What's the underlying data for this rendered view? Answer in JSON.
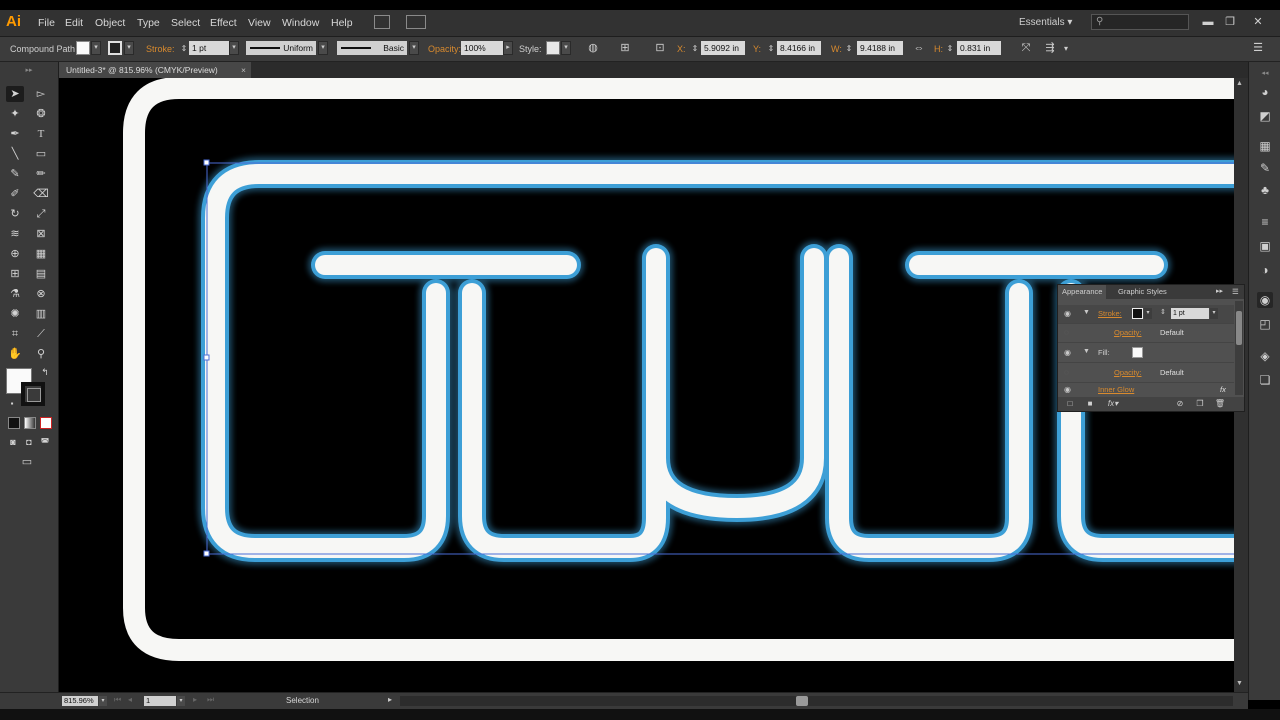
{
  "app": {
    "logo": "Ai"
  },
  "menu": [
    "File",
    "Edit",
    "Object",
    "Type",
    "Select",
    "Effect",
    "View",
    "Window",
    "Help"
  ],
  "workspace": "Essentials",
  "search": {
    "placeholder": ""
  },
  "window_controls": [
    "minimize-icon",
    "restore-icon",
    "close-icon"
  ],
  "controlbar": {
    "selection_type": "Compound Path",
    "stroke_label": "Stroke:",
    "stroke_weight": "1 pt",
    "variable_width": "Uniform",
    "brush": "Basic",
    "opacity_label": "Opacity:",
    "opacity_value": "100%",
    "style_label": "Style:",
    "x_label": "X:",
    "x_value": "5.9092 in",
    "y_label": "Y:",
    "y_value": "8.4166 in",
    "w_label": "W:",
    "w_value": "9.4188 in",
    "h_label": "H:",
    "h_value": "0.831 in"
  },
  "document_tab": {
    "title": "Untitled-3* @ 815.96% (CMYK/Preview)",
    "close": "×"
  },
  "canvas": {
    "artwork_text": "TUTS"
  },
  "appearance_panel": {
    "tabs": [
      "Appearance",
      "Graphic Styles"
    ],
    "rows": [
      {
        "type": "attribute",
        "label": "Stroke:",
        "value": "1 pt",
        "selected": true
      },
      {
        "type": "sub",
        "label": "Opacity:",
        "value": "Default"
      },
      {
        "type": "attribute",
        "label": "Fill:",
        "value": ""
      },
      {
        "type": "sub",
        "label": "Opacity:",
        "value": "Default"
      },
      {
        "type": "effect",
        "label": "Inner Glow",
        "value": "fx"
      }
    ]
  },
  "statusbar": {
    "zoom": "815.96%",
    "artboard": "1",
    "tool_status": "Selection"
  },
  "colors": {
    "neon_blue": "#3d9fd6",
    "neon_core": "#f7f7f5",
    "ui_orange": "#d88a2e"
  }
}
